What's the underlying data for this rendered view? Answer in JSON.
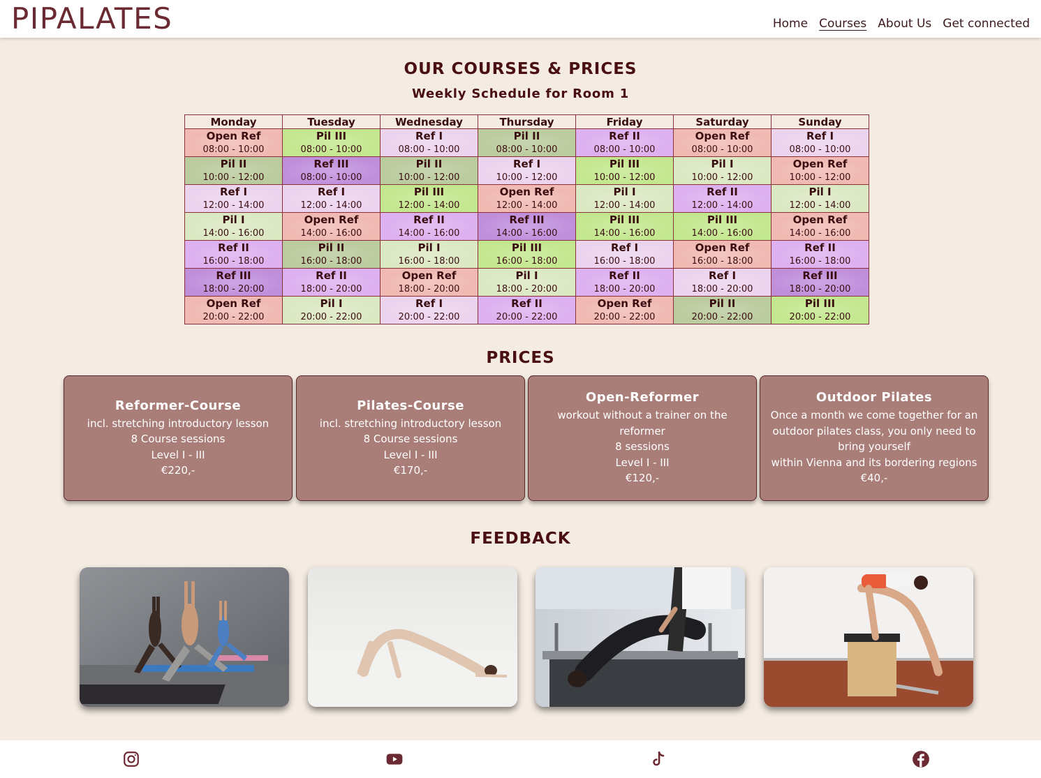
{
  "brand": {
    "logo": "PIPALATES"
  },
  "nav": {
    "items": [
      {
        "label": "Home",
        "active": false
      },
      {
        "label": "Courses",
        "active": true
      },
      {
        "label": "About Us",
        "active": false
      },
      {
        "label": "Get connected",
        "active": false
      }
    ]
  },
  "courses": {
    "title": "OUR COURSES & PRICES",
    "subtitle": "Weekly Schedule for Room 1"
  },
  "schedule": {
    "days": [
      "Monday",
      "Tuesday",
      "Wednesday",
      "Thursday",
      "Friday",
      "Saturday",
      "Sunday"
    ],
    "colors": {
      "Open Ref": "#f0b9b2",
      "Pil I": "#dbe8c2",
      "Pil II": "#bacb9d",
      "Pil III": "#c3e78e",
      "Ref I": "#ecd3ee",
      "Ref II": "#ddb0ef",
      "Ref III": "#c08fdc"
    },
    "rows": [
      [
        [
          "Open Ref",
          "08:00 - 10:00"
        ],
        [
          "Pil III",
          "08:00 - 10:00"
        ],
        [
          "Ref I",
          "08:00 - 10:00"
        ],
        [
          "Pil II",
          "08:00 - 10:00"
        ],
        [
          "Ref II",
          "08:00 - 10:00"
        ],
        [
          "Open Ref",
          "08:00 - 10:00"
        ],
        [
          "Ref I",
          "08:00 - 10:00"
        ]
      ],
      [
        [
          "Pil II",
          "10:00 - 12:00"
        ],
        [
          "Ref III",
          "08:00 - 10:00"
        ],
        [
          "Pil II",
          "10:00 - 12:00"
        ],
        [
          "Ref I",
          "10:00 - 12:00"
        ],
        [
          "Pil III",
          "10:00 - 12:00"
        ],
        [
          "Pil I",
          "10:00 - 12:00"
        ],
        [
          "Open Ref",
          "10:00 - 12:00"
        ]
      ],
      [
        [
          "Ref I",
          "12:00 - 14:00"
        ],
        [
          "Ref I",
          "12:00 - 14:00"
        ],
        [
          "Pil III",
          "12:00 - 14:00"
        ],
        [
          "Open Ref",
          "12:00 - 14:00"
        ],
        [
          "Pil I",
          "12:00 - 14:00"
        ],
        [
          "Ref II",
          "12:00 - 14:00"
        ],
        [
          "Pil I",
          "12:00 - 14:00"
        ]
      ],
      [
        [
          "Pil I",
          "14:00 - 16:00"
        ],
        [
          "Open Ref",
          "14:00 - 16:00"
        ],
        [
          "Ref II",
          "14:00 - 16:00"
        ],
        [
          "Ref III",
          "14:00 - 16:00"
        ],
        [
          "Pil III",
          "14:00 - 16:00"
        ],
        [
          "Pil III",
          "14:00 - 16:00"
        ],
        [
          "Open Ref",
          "14:00 - 16:00"
        ]
      ],
      [
        [
          "Ref II",
          "16:00 - 18:00"
        ],
        [
          "Pil II",
          "16:00 - 18:00"
        ],
        [
          "Pil I",
          "16:00 - 18:00"
        ],
        [
          "Pil III",
          "16:00 - 18:00"
        ],
        [
          "Ref I",
          "16:00 - 18:00"
        ],
        [
          "Open Ref",
          "16:00 - 18:00"
        ],
        [
          "Ref II",
          "16:00 - 18:00"
        ]
      ],
      [
        [
          "Ref III",
          "18:00 - 20:00"
        ],
        [
          "Ref II",
          "18:00 - 20:00"
        ],
        [
          "Open Ref",
          "18:00 - 20:00"
        ],
        [
          "Pil I",
          "18:00 - 20:00"
        ],
        [
          "Ref II",
          "18:00 - 20:00"
        ],
        [
          "Ref I",
          "18:00 - 20:00"
        ],
        [
          "Ref III",
          "18:00 - 20:00"
        ]
      ],
      [
        [
          "Open Ref",
          "20:00 - 22:00"
        ],
        [
          "Pil I",
          "20:00 - 22:00"
        ],
        [
          "Ref I",
          "20:00 - 22:00"
        ],
        [
          "Ref II",
          "20:00 - 22:00"
        ],
        [
          "Open Ref",
          "20:00 - 22:00"
        ],
        [
          "Pil II",
          "20:00 - 22:00"
        ],
        [
          "Pil III",
          "20:00 - 22:00"
        ]
      ]
    ]
  },
  "prices": {
    "title": "PRICES",
    "cards": [
      {
        "title": "Reformer-Course",
        "lines": [
          "incl. stretching introductory lesson",
          "8 Course sessions",
          "Level I - III",
          "€220,-"
        ]
      },
      {
        "title": "Pilates-Course",
        "lines": [
          "incl. stretching introductory lesson",
          "8 Course sessions",
          "Level I - III",
          "€170,-"
        ]
      },
      {
        "title": "Open-Reformer",
        "lines": [
          "workout without a trainer on the reformer",
          "8 sessions",
          "Level I - III",
          "€120,-"
        ]
      },
      {
        "title": "Outdoor Pilates",
        "lines": [
          "Once a month we come together for an outdoor pilates class, you only need to bring yourself",
          "within Vienna and its bordering regions",
          "€40,-"
        ]
      }
    ]
  },
  "feedback": {
    "title": "FEEDBACK",
    "photos": [
      "yoga-group-photo",
      "floor-bridge-photo",
      "reformer-bridge-photo",
      "wunda-chair-photo"
    ]
  },
  "footer": {
    "social": [
      "instagram-icon",
      "youtube-icon",
      "tiktok-icon",
      "facebook-icon"
    ],
    "icon_color": "#6b2a32"
  }
}
